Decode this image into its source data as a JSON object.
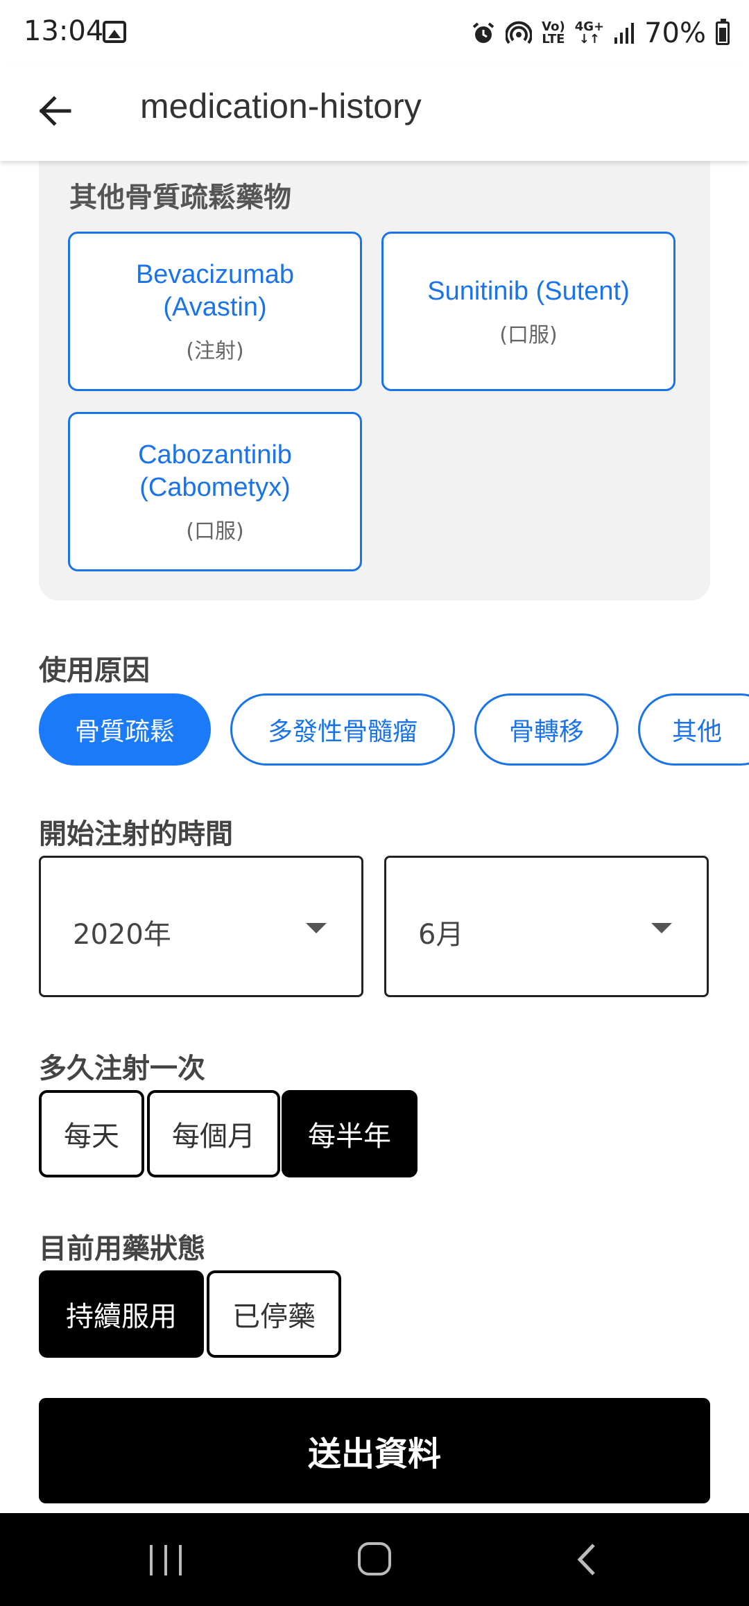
{
  "status_bar": {
    "time": "13:04",
    "battery": "70%",
    "volte_top": "Vo)",
    "volte_bottom": "LTE",
    "network": "4G+",
    "icons": [
      "gallery-icon",
      "alarm-icon",
      "hotspot-icon",
      "volte-icon",
      "4g-icon",
      "signal-icon",
      "battery-icon"
    ]
  },
  "app_bar": {
    "title": "medication-history",
    "back_icon": "arrow-left-icon"
  },
  "other_drugs": {
    "heading": "其他骨質疏鬆藥物",
    "items": [
      {
        "name": "Bevacizumab\n(Avastin)",
        "route": "(注射)"
      },
      {
        "name": "Sunitinib (Sutent)",
        "route": "(口服)"
      },
      {
        "name": "Cabozantinib\n(Cabometyx)",
        "route": "(口服)"
      }
    ]
  },
  "reason": {
    "label": "使用原因",
    "options": [
      "骨質疏鬆",
      "多發性骨髓瘤",
      "骨轉移",
      "其他"
    ],
    "selected": "骨質疏鬆"
  },
  "start_time": {
    "label": "開始注射的時間",
    "year": "2020年",
    "month": "6月"
  },
  "frequency": {
    "label": "多久注射一次",
    "options": [
      "每天",
      "每個月",
      "每半年"
    ],
    "selected": "每半年"
  },
  "status": {
    "label": "目前用藥狀態",
    "options": [
      "持續服用",
      "已停藥"
    ],
    "selected": "持續服用"
  },
  "submit_label": "送出資料",
  "colors": {
    "accent": "#1a73e8",
    "selected_chip": "#1a7af8",
    "card_bg": "#f2f2f2",
    "primary_button": "#000000"
  }
}
